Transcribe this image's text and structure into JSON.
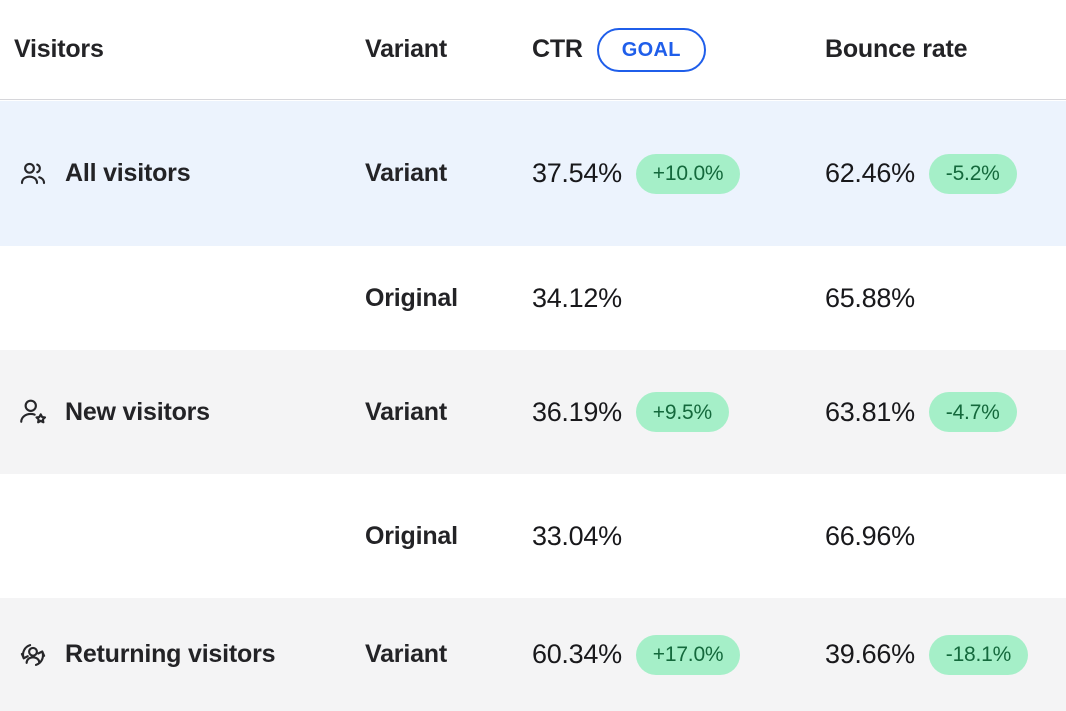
{
  "header": {
    "visitors_label": "Visitors",
    "variant_label": "Variant",
    "ctr_label": "CTR",
    "goal_badge_label": "GOAL",
    "bounce_label": "Bounce rate"
  },
  "colors": {
    "goal_accent": "#1f5eea",
    "highlight_row_bg": "#ecf3fd",
    "alt_row_bg": "#f4f4f5",
    "delta_badge_bg": "#a5efc8",
    "delta_badge_text": "#14693c",
    "text_primary": "#232326"
  },
  "rows": [
    {
      "icon": "users-group-icon",
      "segment": "All visitors",
      "variant": "Variant",
      "ctr_value": "37.54%",
      "ctr_delta": "+10.0%",
      "bounce_value": "62.46%",
      "bounce_delta": "-5.2%",
      "background": "blue",
      "highlighted": true
    },
    {
      "icon": "",
      "segment": "",
      "variant": "Original",
      "ctr_value": "34.12%",
      "ctr_delta": "",
      "bounce_value": "65.88%",
      "bounce_delta": "",
      "background": "white",
      "highlighted": false
    },
    {
      "icon": "new-user-icon",
      "segment": "New visitors",
      "variant": "Variant",
      "ctr_value": "36.19%",
      "ctr_delta": "+9.5%",
      "bounce_value": "63.81%",
      "bounce_delta": "-4.7%",
      "background": "gray",
      "highlighted": false
    },
    {
      "icon": "",
      "segment": "",
      "variant": "Original",
      "ctr_value": "33.04%",
      "ctr_delta": "",
      "bounce_value": "66.96%",
      "bounce_delta": "",
      "background": "white",
      "highlighted": false
    },
    {
      "icon": "returning-user-icon",
      "segment": "Returning visitors",
      "variant": "Variant",
      "ctr_value": "60.34%",
      "ctr_delta": "+17.0%",
      "bounce_value": "39.66%",
      "bounce_delta": "-18.1%",
      "background": "gray",
      "highlighted": false
    }
  ]
}
